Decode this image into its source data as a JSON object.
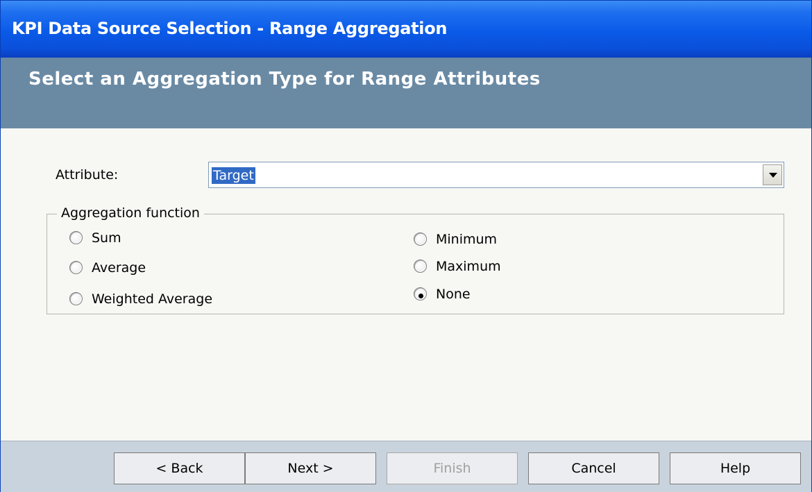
{
  "window": {
    "title": "KPI Data Source Selection - Range Aggregation"
  },
  "banner": {
    "heading": "Select an Aggregation Type for Range Attributes"
  },
  "attribute": {
    "label": "Attribute:",
    "value": "Target"
  },
  "aggregation": {
    "legend": "Aggregation function",
    "options": [
      {
        "label": "Sum",
        "selected": false
      },
      {
        "label": "Average",
        "selected": false
      },
      {
        "label": "Weighted Average",
        "selected": false
      },
      {
        "label": "Minimum",
        "selected": false
      },
      {
        "label": "Maximum",
        "selected": false
      },
      {
        "label": "None",
        "selected": true
      }
    ]
  },
  "buttons": {
    "back": "< Back",
    "next": "Next >",
    "finish": "Finish",
    "cancel": "Cancel",
    "help": "Help"
  }
}
